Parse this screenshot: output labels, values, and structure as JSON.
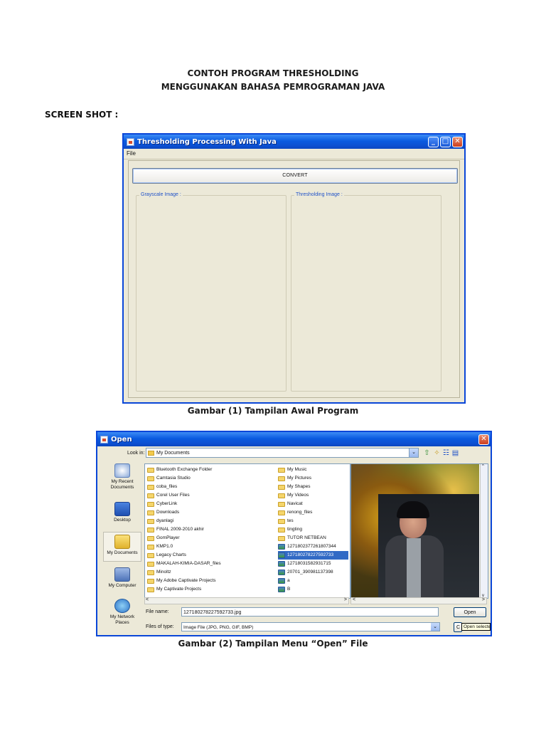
{
  "doc": {
    "title_line1": "CONTOH PROGRAM THRESHOLDING",
    "title_line2": "MENGGUNAKAN BAHASA PEMROGRAMAN JAVA",
    "section_label": "SCREEN SHOT :",
    "caption1": "Gambar (1) Tampilan Awal Program",
    "caption2": "Gambar (2) Tampilan Menu “Open” File"
  },
  "window1": {
    "title": "Thresholding Processing With Java",
    "menu_file": "File",
    "convert_label": "CONVERT",
    "grayscale_legend": "Grayscale Image :",
    "threshold_legend": "Thresholding Image :",
    "minimize": "_",
    "maximize": "□",
    "close": "✕"
  },
  "dialog": {
    "title": "Open",
    "close": "✕",
    "lookin_label": "Look in:",
    "lookin_value": "My Documents",
    "dropdown_arrow": "⌄",
    "places": [
      "My Recent Documents",
      "Desktop",
      "My Documents",
      "My Computer",
      "My Network Places"
    ],
    "files_col1": [
      "Bluetooth Exchange Folder",
      "Camtasia Studio",
      "coba_files",
      "Corel User Files",
      "CyberLink",
      "Downloads",
      "dyanlagi",
      "FINAL 2009-2010 akhir",
      "GomPlayer",
      "KMP1.0",
      "Legacy Charts",
      "MAKALAH-KIMIA-DASAR_files",
      "Minoltz",
      "My Adobe Captivate Projects",
      "My Captivate Projects"
    ],
    "files_col2": [
      "My Music",
      "My Pictures",
      "My Shapes",
      "My Videos",
      "Navicat",
      "renong_files",
      "tes",
      "tingting",
      "TUTOR NETBEAN",
      "1271802377261807344",
      "127180278227592733",
      "12718031582931715",
      "20701_390981137398",
      "a",
      "B"
    ],
    "selected_file": "127180278227592733",
    "file_name_label": "File name:",
    "file_name_value": "127180278227592733.jpg",
    "file_type_label": "Files of type:",
    "file_type_value": "Image File (JPG, PNG, GIF, BMP)",
    "open_button": "Open",
    "cancel_button": "C",
    "tooltip": "Open selected",
    "scroll_left": "<",
    "scroll_right": ">",
    "scroll_up": "^",
    "scroll_down": "v"
  }
}
